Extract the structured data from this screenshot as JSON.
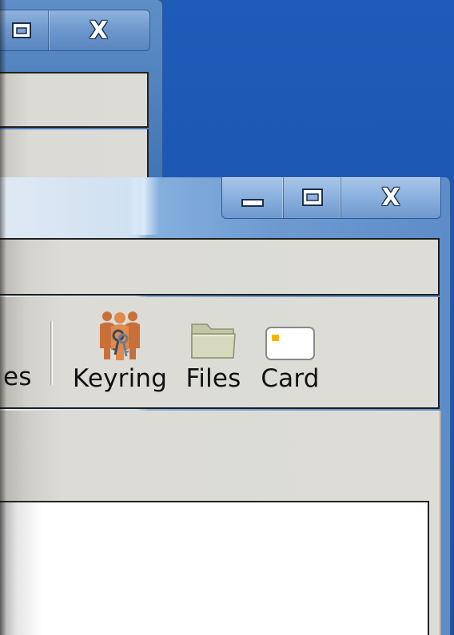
{
  "back_window": {
    "caption_buttons": [
      {
        "name": "maximize",
        "icon": "maximize-icon"
      },
      {
        "name": "close",
        "label": "X",
        "icon": "close-icon"
      }
    ]
  },
  "front_window": {
    "caption_buttons": [
      {
        "name": "minimize",
        "icon": "minimize-icon"
      },
      {
        "name": "maximize",
        "icon": "maximize-icon"
      },
      {
        "name": "close",
        "label": "X",
        "icon": "close-icon"
      }
    ],
    "toolbar": {
      "cut_off_label": "es",
      "buttons": [
        {
          "label": "Keyring",
          "icon": "keyring-icon"
        },
        {
          "label": "Files",
          "icon": "folder-icon"
        },
        {
          "label": "Card",
          "icon": "card-icon"
        }
      ]
    }
  },
  "colors": {
    "desktop": "#1d56b3",
    "window_frame": "#6d9bd1",
    "panel": "#dcdbd6",
    "card_chip": "#f5b400"
  }
}
